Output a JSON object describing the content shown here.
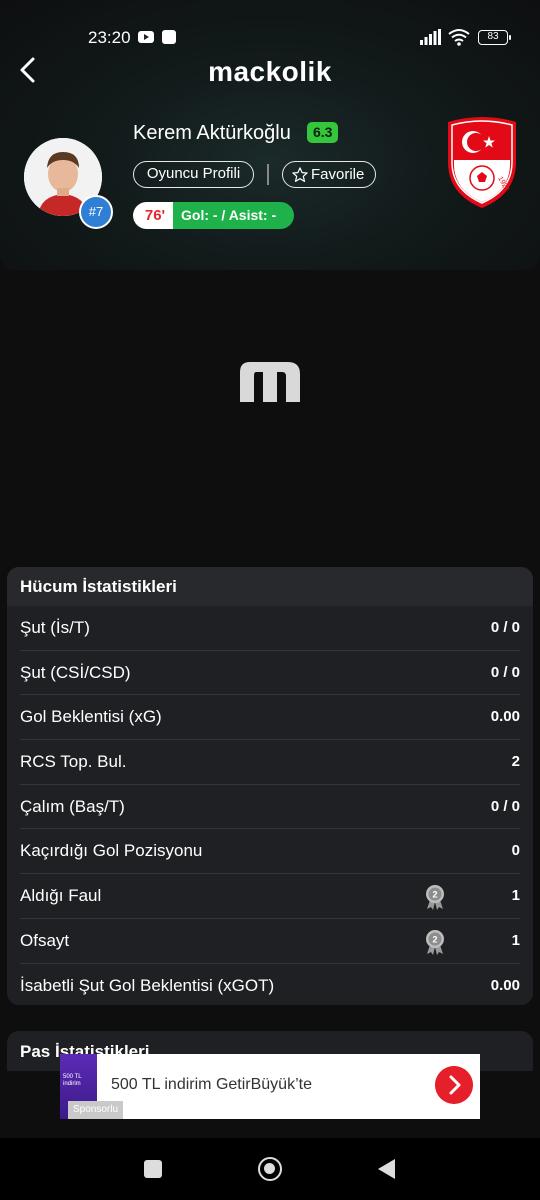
{
  "status_bar": {
    "time": "23:20",
    "battery": "83",
    "icons": [
      "youtube-icon",
      "notification-icon",
      "signal-icon",
      "wifi-icon",
      "battery-icon"
    ]
  },
  "header": {
    "brand": "mackolik",
    "back_icon": "chevron-left-icon"
  },
  "player": {
    "name": "Kerem Aktürkoğlu",
    "rating": "6.3",
    "jersey_number": "#7",
    "profile_button": "Oyuncu Profili",
    "favorite_button": "Favorile",
    "minute": "76'",
    "goal_assist": "Gol: - / Asist: -",
    "team_crest_text": "1923"
  },
  "colors": {
    "rating_green": "#34c73c",
    "goal_badge_green": "#1fb14a",
    "minute_red": "#e8262e",
    "jersey_blue": "#2f7fd6",
    "card_bg": "#1f2023",
    "crest_red": "#e30a17"
  },
  "attack_stats": {
    "title": "Hücum İstatistikleri",
    "rows": [
      {
        "label": "Şut (İs/T)",
        "value": "0 / 0",
        "medal": false
      },
      {
        "label": "Şut (CSİ/CSD)",
        "value": "0 / 0",
        "medal": false
      },
      {
        "label": "Gol Beklentisi (xG)",
        "value": "0.00",
        "medal": false
      },
      {
        "label": "RCS Top. Bul.",
        "value": "2",
        "medal": false
      },
      {
        "label": "Çalım (Baş/T)",
        "value": "0 / 0",
        "medal": false
      },
      {
        "label": "Kaçırdığı Gol Pozisyonu",
        "value": "0",
        "medal": false
      },
      {
        "label": "Aldığı Faul",
        "value": "1",
        "medal": true,
        "medal_rank": "2"
      },
      {
        "label": "Ofsayt",
        "value": "1",
        "medal": true,
        "medal_rank": "2"
      },
      {
        "label": "İsabetli Şut Gol Beklentisi (xGOT)",
        "value": "0.00",
        "medal": false
      }
    ]
  },
  "pass_stats": {
    "title": "Pas İstatistikleri"
  },
  "ad": {
    "text": "500 TL indirim GetirBüyük’te",
    "sponsor_label": "Sponsorlu",
    "thumb_text": "500 TL indirim"
  },
  "nav": {
    "icons": [
      "recent-apps-icon",
      "home-icon",
      "back-icon"
    ]
  }
}
